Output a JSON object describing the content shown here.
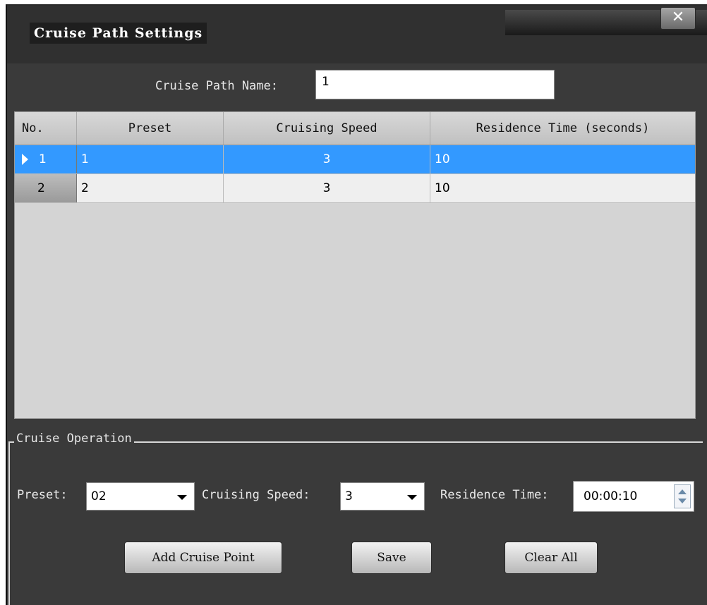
{
  "dialog": {
    "title": "Cruise Path Settings",
    "close_symbol": "✕"
  },
  "path_name": {
    "label": "Cruise Path Name:",
    "value": "1"
  },
  "table": {
    "headers": [
      "No.",
      "Preset",
      "Cruising Speed",
      "Residence Time (seconds)"
    ],
    "rows": [
      {
        "no": "1",
        "preset": "1",
        "speed": "3",
        "time": "10",
        "selected": true
      },
      {
        "no": "2",
        "preset": "2",
        "speed": "3",
        "time": "10",
        "selected": false
      }
    ]
  },
  "operation": {
    "group_label": "Cruise Operation",
    "preset_label": "Preset:",
    "preset_value": "02",
    "speed_label": "Cruising Speed:",
    "speed_value": "3",
    "time_label": "Residence Time:",
    "time_value": "00:00:10",
    "add_button": "Add Cruise Point",
    "save_button": "Save",
    "clear_button": "Clear All"
  },
  "colors": {
    "selection": "#3399ff",
    "dialog_bg": "#3a3a3a",
    "grid_bg": "#d4d4d4"
  },
  "icons": {
    "close": "close-icon",
    "row_pointer": "triangle-right-icon",
    "dropdown": "chevron-down-icon",
    "spinner": "spinner-icon"
  }
}
